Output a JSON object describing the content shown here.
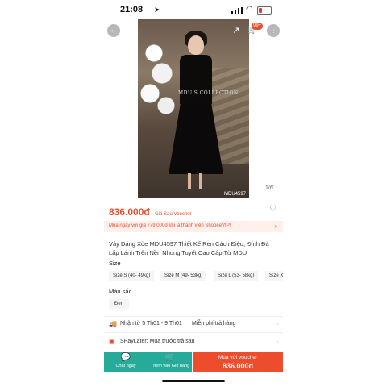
{
  "status": {
    "time": "21:08",
    "location_icon": "location-arrow-icon",
    "battery_level": 0.25,
    "battery_color": "#e53935"
  },
  "header": {
    "cart_badge": "99+",
    "back_icon": "back-arrow-icon",
    "share_icon": "share-icon",
    "cart_icon": "cart-icon",
    "more_icon": "more-icon"
  },
  "gallery": {
    "caption": "MDU'S COLLECTION",
    "code": "MDU4597",
    "page": "1/6"
  },
  "price": {
    "value": "836.000đ",
    "note": "Giá Sau Voucher"
  },
  "vip": {
    "text": "Mua ngay với giá 779.000đ khi là thành viên ShopeeVIP!"
  },
  "product": {
    "title": "Váy Dáng Xòe MDU4597 Thiết Kế Ren Cách Điệu, Đính Đá Lấp Lánh Trên Nền Nhung Tuyết Cao Cấp Từ MDU"
  },
  "size": {
    "label": "Size",
    "options": [
      "Size S (40- 49kg)",
      "Size M (49- 53kg)",
      "Size L (53- 58kg)",
      "Size X"
    ]
  },
  "color": {
    "label": "Màu sắc",
    "options": [
      "Đen"
    ]
  },
  "shipping": {
    "delivery": "Nhận từ 5 Th01 - 9 Th01",
    "returns": "Miễn phí trả hàng"
  },
  "paylater": {
    "text": "SPayLater: Mua trước trả sau"
  },
  "bottom_bar": {
    "chat": "Chat ngay",
    "add_cart": "Thêm vào Giỏ hàng",
    "buy_label": "Mua với voucher",
    "buy_price": "836.000đ"
  },
  "colors": {
    "accent": "#ee4d2d",
    "teal": "#26aa99"
  }
}
